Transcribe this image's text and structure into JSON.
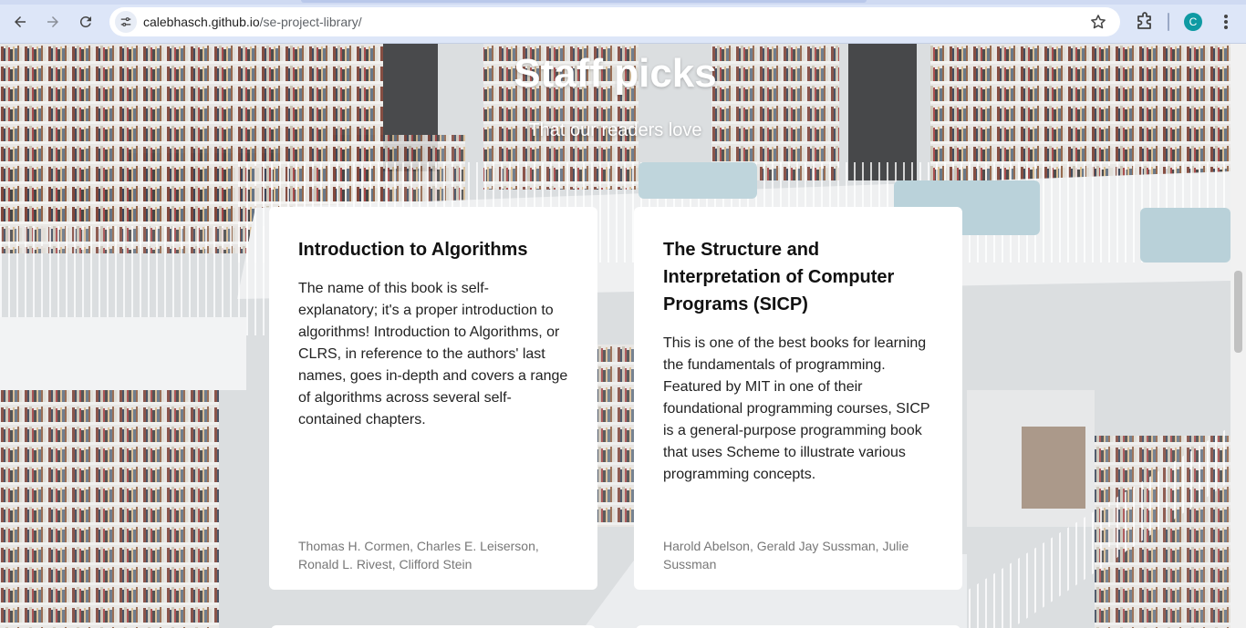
{
  "browser": {
    "url_host": "calebhasch.github.io",
    "url_path": "/se-project-library/",
    "profile_initial": "C"
  },
  "hero": {
    "title": "Staff picks",
    "subtitle": "That our readers love"
  },
  "cards": [
    {
      "title": "Introduction to Algorithms",
      "description": "The name of this book is self-explanatory; it's a proper introduction to algorithms! Introduction to Algorithms, or CLRS, in reference to the authors' last names, goes in-depth and covers a range of algorithms across several self-contained chapters.",
      "authors": "Thomas H. Cormen, Charles E. Leiserson, Ronald L. Rivest, Clifford Stein"
    },
    {
      "title": "The Structure and Interpretation of Computer Programs (SICP)",
      "description": "This is one of the best books for learning the fundamentals of programming. Featured by MIT in one of their foundational programming courses, SICP is a general-purpose programming book that uses Scheme to illustrate various programming concepts.",
      "authors": "Harold Abelson, Gerald Jay Sussman, Julie Sussman"
    }
  ],
  "icons": {
    "back": "arrow-left-icon",
    "forward": "arrow-right-icon",
    "reload": "reload-icon",
    "site_info": "tune-icon",
    "bookmark": "star-icon",
    "extensions": "puzzle-icon",
    "menu": "kebab-menu-icon"
  }
}
